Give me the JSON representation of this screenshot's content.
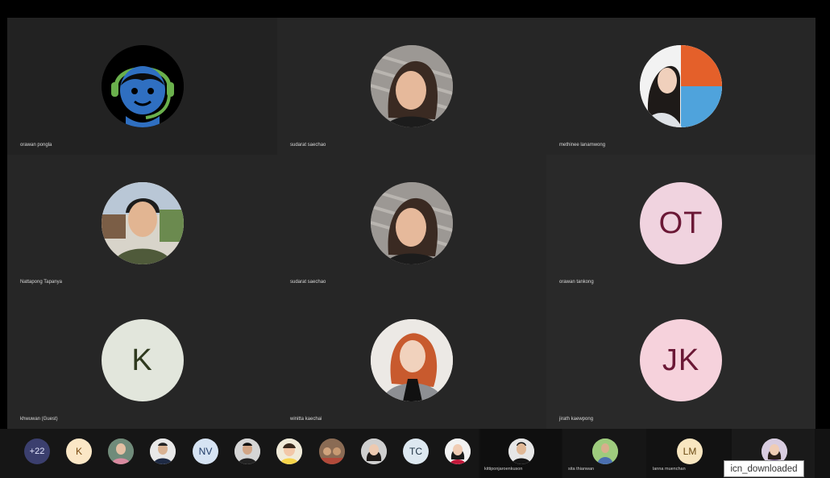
{
  "participants": [
    {
      "name": "orawan pongla",
      "avatar_icon": "headset-agent-icon"
    },
    {
      "name": "sudarat saechao",
      "avatar_icon": "user-photo"
    },
    {
      "name": "methinee lanamwong",
      "avatar_icon": "user-photo"
    },
    {
      "name": "Nattapong Tapanya",
      "avatar_icon": "user-photo"
    },
    {
      "name": "sudarat saechao",
      "avatar_icon": "user-photo"
    },
    {
      "name": "orawan tankong",
      "initials": "OT",
      "avatar_bg": "#f0d3df",
      "avatar_fg": "#6b1836"
    },
    {
      "name": "khwuwan (Guest)",
      "initials": "K",
      "avatar_bg": "#e2e6dc",
      "avatar_fg": "#2f3a1f"
    },
    {
      "name": "winitta kaechai",
      "avatar_icon": "user-photo"
    },
    {
      "name": "jirath kaewpong",
      "initials": "JK",
      "avatar_bg": "#f6d2dc",
      "avatar_fg": "#6b1836"
    }
  ],
  "strip": {
    "overflow_count": "+22",
    "thumbs": [
      {
        "initials": "K",
        "bg": "#fbe7c6",
        "fg": "#7a4b12"
      },
      {
        "icon": "user-photo"
      },
      {
        "icon": "user-photo"
      },
      {
        "initials": "NV",
        "bg": "#d6e3f3",
        "fg": "#1e3a66"
      },
      {
        "icon": "user-photo"
      },
      {
        "icon": "user-photo"
      },
      {
        "icon": "user-photo"
      },
      {
        "icon": "user-photo"
      },
      {
        "initials": "TC",
        "bg": "#dde8f0",
        "fg": "#1f3344"
      },
      {
        "icon": "user-photo"
      }
    ],
    "named_tiles": [
      {
        "name": "kittiponjaroenkuson"
      },
      {
        "name": "sita thianwan"
      },
      {
        "name": "lanna muenchan",
        "initials": "LM",
        "bg": "#f8e6c0",
        "fg": "#6b4a12"
      },
      {
        "name": ""
      }
    ]
  },
  "tooltip": "icn_downloaded",
  "colors": {
    "tile": "#262626",
    "background": "#000000",
    "green": "#6ab04c",
    "blue": "#2f6fc1"
  }
}
